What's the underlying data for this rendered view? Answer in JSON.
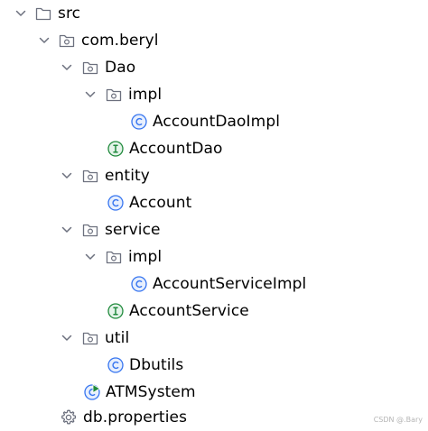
{
  "tree": {
    "src": {
      "label": "src",
      "icon": "folder-icon"
    },
    "com_beryl": {
      "label": "com.beryl",
      "icon": "package-icon"
    },
    "dao": {
      "label": "Dao",
      "icon": "package-icon"
    },
    "dao_impl": {
      "label": "impl",
      "icon": "package-icon"
    },
    "account_dao_impl": {
      "label": "AccountDaoImpl",
      "icon": "class-icon"
    },
    "account_dao": {
      "label": "AccountDao",
      "icon": "interface-icon"
    },
    "entity": {
      "label": "entity",
      "icon": "package-icon"
    },
    "account": {
      "label": "Account",
      "icon": "class-icon"
    },
    "service": {
      "label": "service",
      "icon": "package-icon"
    },
    "service_impl": {
      "label": "impl",
      "icon": "package-icon"
    },
    "account_service_impl": {
      "label": "AccountServiceImpl",
      "icon": "class-icon"
    },
    "account_service": {
      "label": "AccountService",
      "icon": "interface-icon"
    },
    "util": {
      "label": "util",
      "icon": "package-icon"
    },
    "dbutils": {
      "label": "Dbutils",
      "icon": "class-icon"
    },
    "atm_system": {
      "label": "ATMSystem",
      "icon": "main-class-icon"
    },
    "db_properties": {
      "label": "db.properties",
      "icon": "gear-icon"
    }
  },
  "watermark": "CSDN @.Bary",
  "colors": {
    "chevron": "#6c707e",
    "folder_stroke": "#6c707e",
    "class_blue": "#3574f0",
    "class_fill": "#e7effd",
    "interface_green": "#208a3c",
    "interface_fill": "#e5f4ea",
    "gear": "#6c707e"
  }
}
